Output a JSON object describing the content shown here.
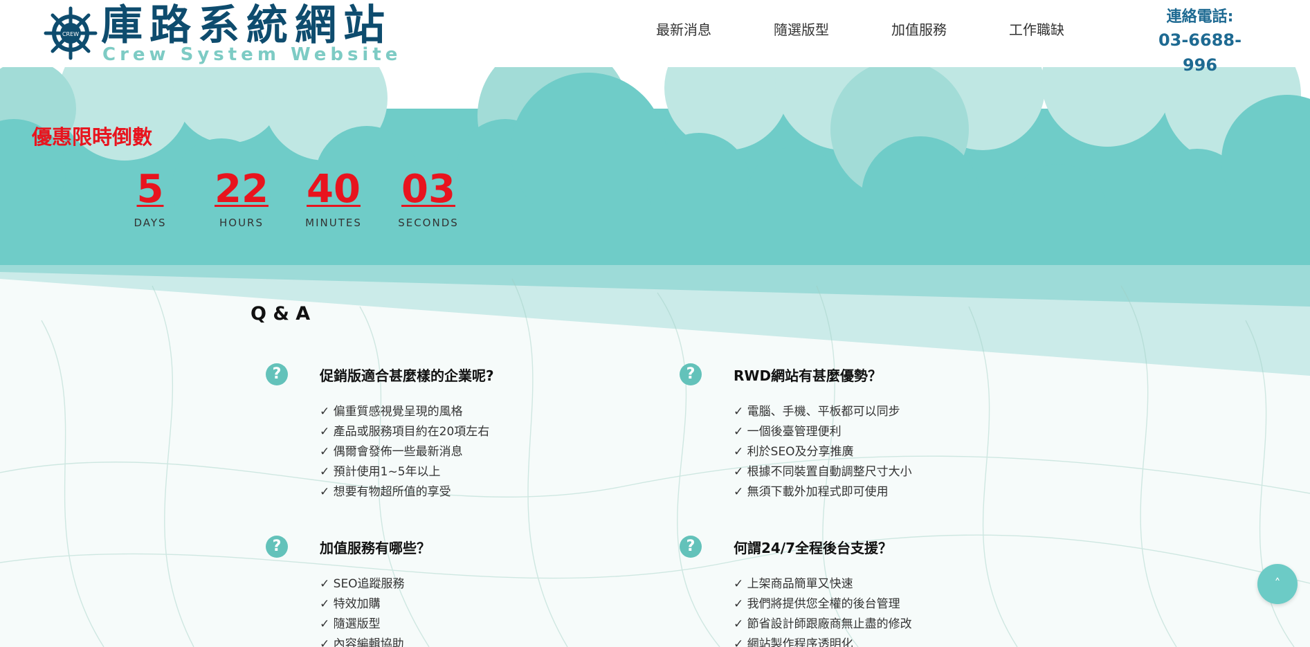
{
  "header": {
    "logo_title": "庫路系統網站",
    "logo_subtitle": "Crew System Website",
    "logo_emblem_text": "CREW",
    "nav": [
      "最新消息",
      "隨選版型",
      "加值服務",
      "工作職缺"
    ],
    "contact_label": "連絡電話:",
    "contact_phone": "03-6688-996"
  },
  "promo": {
    "title": "優惠限時倒數",
    "countdown": [
      {
        "value": "5",
        "label": "DAYS"
      },
      {
        "value": "22",
        "label": "HOURS"
      },
      {
        "value": "40",
        "label": "MINUTES"
      },
      {
        "value": "03",
        "label": "SECONDS"
      }
    ]
  },
  "qa": {
    "heading": "Q & A",
    "icon_glyph": "?",
    "items": [
      {
        "question": "促銷版適合甚麼樣的企業呢?",
        "answers": [
          "✓ 偏重質感視覺呈現的風格",
          "✓ 產品或服務項目約在20項左右",
          "✓ 偶爾會發佈一些最新消息",
          "✓ 預計使用1~5年以上",
          "✓ 想要有物超所值的享受"
        ]
      },
      {
        "question": "RWD網站有甚麼優勢？",
        "answers": [
          "✓ 電腦、手機、平板都可以同步",
          "✓ 一個後臺管理便利",
          "✓ 利於SEO及分享推廣",
          "✓ 根據不同裝置自動調整尺寸大小",
          "✓ 無須下載外加程式即可使用"
        ]
      },
      {
        "question": "加值服務有哪些？",
        "answers": [
          "✓ SEO追蹤服務",
          "✓ 特效加購",
          "✓ 隨選版型",
          "✓ 內容編輯協助"
        ]
      },
      {
        "question": "何謂24/7全程後台支援？",
        "answers": [
          "✓ 上架商品簡單又快速",
          "✓ 我們將提供您全權的後台管理",
          "✓ 節省設計師跟廠商無止盡的修改",
          "✓ 網站製作程序透明化"
        ]
      }
    ]
  },
  "back_to_top": {
    "icon": "chevron-up-icon",
    "glyph": "˄"
  },
  "colors": {
    "brand_dark": "#0e4c6e",
    "brand_light": "#7dcbc4",
    "teal": "#6fccc8",
    "accent_red": "#e8141e",
    "phone_blue": "#1e6a92"
  }
}
